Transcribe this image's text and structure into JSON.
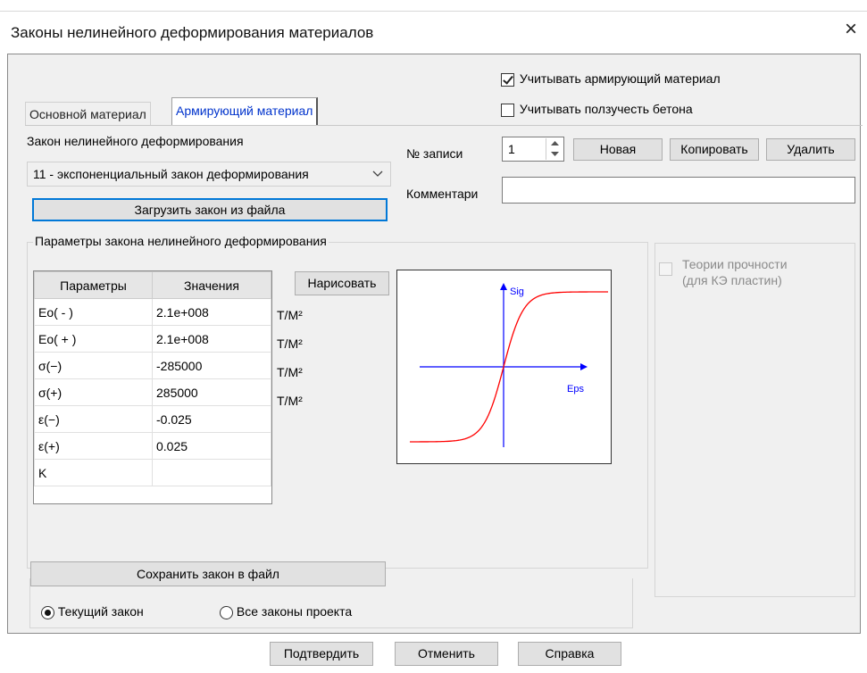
{
  "window": {
    "title": "Законы нелинейного деформирования материалов",
    "close_symbol": "×"
  },
  "options": {
    "consider_reinforcement": "Учитывать армирующий материал",
    "consider_creep": "Учитывать ползучесть бетона"
  },
  "tabs": [
    {
      "label": "Основной материал",
      "active": false
    },
    {
      "label": "Армирующий материал",
      "active": true
    }
  ],
  "law": {
    "label": "Закон нелинейного деформирования",
    "selected": "11 - экспоненциальный закон деформирования",
    "load_button": "Загрузить закон из файла"
  },
  "record": {
    "label": "№ записи",
    "value": "1",
    "new_button": "Новая",
    "copy_button": "Копировать",
    "delete_button": "Удалить",
    "comment_label": "Комментари",
    "comment_value": ""
  },
  "params": {
    "group_label": "Параметры закона нелинейного деформирования",
    "col_param": "Параметры",
    "col_value": "Значения",
    "draw_button": "Нарисовать",
    "rows": [
      {
        "name": "Eo( - )",
        "value": "2.1e+008",
        "unit": "Т/М²"
      },
      {
        "name": "Eo( + )",
        "value": "2.1e+008",
        "unit": "Т/М²"
      },
      {
        "name": "σ(−)",
        "value": "-285000",
        "unit": "Т/М²"
      },
      {
        "name": "σ(+)",
        "value": "285000",
        "unit": "Т/М²"
      },
      {
        "name": "ε(−)",
        "value": "-0.025",
        "unit": ""
      },
      {
        "name": "ε(+)",
        "value": "0.025",
        "unit": ""
      },
      {
        "name": "K",
        "value": "",
        "unit": ""
      }
    ],
    "save_button": "Сохранить закон в файл"
  },
  "plot": {
    "y_label": "Sig",
    "x_label": "Eps",
    "curve_color": "#ff0000",
    "axis_color": "#0000ff"
  },
  "strength": {
    "label_line1": "Теории прочности",
    "label_line2": "(для КЭ пластин)"
  },
  "scope": {
    "current_law": "Текущий закон",
    "all_laws": "Все законы проекта",
    "selected": "current"
  },
  "footer": {
    "confirm": "Подтвердить",
    "cancel": "Отменить",
    "help": "Справка"
  }
}
